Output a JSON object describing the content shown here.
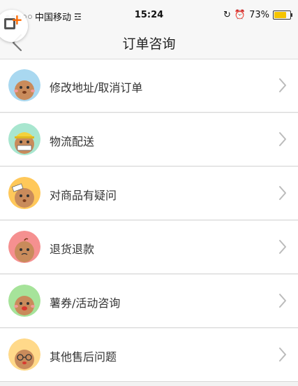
{
  "status_bar": {
    "carrier": "中国移动",
    "time": "15:24",
    "battery": "73%",
    "battery_level": 0.73
  },
  "nav": {
    "title": "订单咨询",
    "back_icon": "chevron-left-icon"
  },
  "menu": [
    {
      "label": "修改地址/取消订单",
      "avatar_color": "#a9d8f0"
    },
    {
      "label": "物流配送",
      "avatar_color": "#a8e6cf"
    },
    {
      "label": "对商品有疑问",
      "avatar_color": "#ffc85a"
    },
    {
      "label": "退货退款",
      "avatar_color": "#f59090"
    },
    {
      "label": "薯券/活动咨询",
      "avatar_color": "#a6e39a"
    },
    {
      "label": "其他售后问题",
      "avatar_color": "#ffd98a"
    }
  ],
  "colors": {
    "background": "#f2f2f2",
    "row": "#ffffff",
    "text": "#333333",
    "chevron": "#bbbbbb"
  }
}
